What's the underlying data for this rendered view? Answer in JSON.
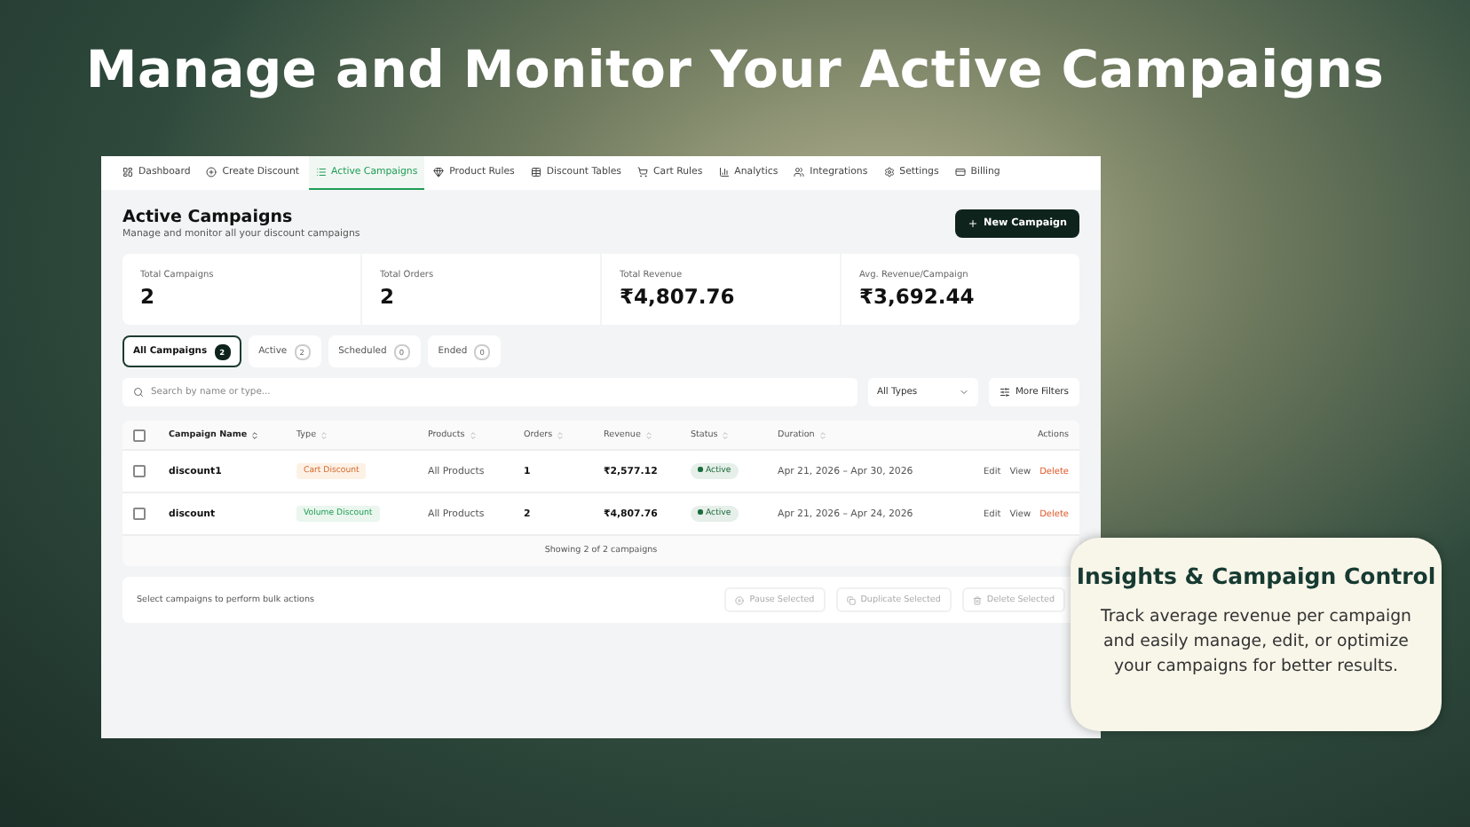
{
  "headline": "Manage and Monitor Your Active Campaigns",
  "nav": [
    {
      "label": "Dashboard",
      "selected": false
    },
    {
      "label": "Create Discount",
      "selected": false
    },
    {
      "label": "Active Campaigns",
      "selected": true
    },
    {
      "label": "Product Rules",
      "selected": false
    },
    {
      "label": "Discount Tables",
      "selected": false
    },
    {
      "label": "Cart Rules",
      "selected": false
    },
    {
      "label": "Analytics",
      "selected": false
    },
    {
      "label": "Integrations",
      "selected": false
    },
    {
      "label": "Settings",
      "selected": false
    },
    {
      "label": "Billing",
      "selected": false
    }
  ],
  "page": {
    "title": "Active Campaigns",
    "subtitle": "Manage and monitor all your discount campaigns",
    "new_button": "New Campaign"
  },
  "stats": [
    {
      "label": "Total Campaigns",
      "value": "2"
    },
    {
      "label": "Total Orders",
      "value": "2"
    },
    {
      "label": "Total Revenue",
      "value": "₹4,807.76"
    },
    {
      "label": "Avg. Revenue/Campaign",
      "value": "₹3,692.44"
    }
  ],
  "filter_tabs": [
    {
      "label": "All Campaigns",
      "count": "2",
      "selected": true
    },
    {
      "label": "Active",
      "count": "2",
      "selected": false
    },
    {
      "label": "Scheduled",
      "count": "0",
      "selected": false
    },
    {
      "label": "Ended",
      "count": "0",
      "selected": false
    }
  ],
  "search": {
    "placeholder": "Search by name or type..."
  },
  "type_select": "All Types",
  "more_filters": "More Filters",
  "table": {
    "select_all_checked": false,
    "columns": [
      {
        "label": "Campaign Name",
        "sortable": true
      },
      {
        "label": "Type",
        "sortable": true
      },
      {
        "label": "Products",
        "sortable": true
      },
      {
        "label": "Orders",
        "sortable": true
      },
      {
        "label": "Revenue",
        "sortable": true
      },
      {
        "label": "Status",
        "sortable": true
      },
      {
        "label": "Duration",
        "sortable": true
      },
      {
        "label": "Actions",
        "sortable": false
      }
    ],
    "rows": [
      {
        "checked": false,
        "name": "discount1",
        "type": "Cart Discount",
        "kind": "cart",
        "products": "All Products",
        "orders": "1",
        "revenue": "₹2,577.12",
        "status": "Active",
        "duration": "Apr 21, 2026 – Apr 30, 2026",
        "actions": [
          "Edit",
          "View",
          "Delete"
        ]
      },
      {
        "checked": false,
        "name": "discount",
        "type": "Volume Discount",
        "kind": "volume",
        "products": "All Products",
        "orders": "2",
        "revenue": "₹4,807.76",
        "status": "Active",
        "duration": "Apr 21, 2026 – Apr 24, 2026",
        "actions": [
          "Edit",
          "View",
          "Delete"
        ]
      }
    ],
    "footer": "Showing 2 of 2 campaigns"
  },
  "bulk": {
    "hint": "Select campaigns to perform bulk actions",
    "actions": [
      {
        "label": "Pause Selected",
        "disabled": true
      },
      {
        "label": "Duplicate Selected",
        "disabled": true
      },
      {
        "label": "Delete Selected",
        "disabled": true
      }
    ]
  },
  "callout": {
    "title": "Insights & Campaign Control",
    "body": "Track average revenue per campaign and easily manage, edit, or optimize your campaigns for better results."
  }
}
